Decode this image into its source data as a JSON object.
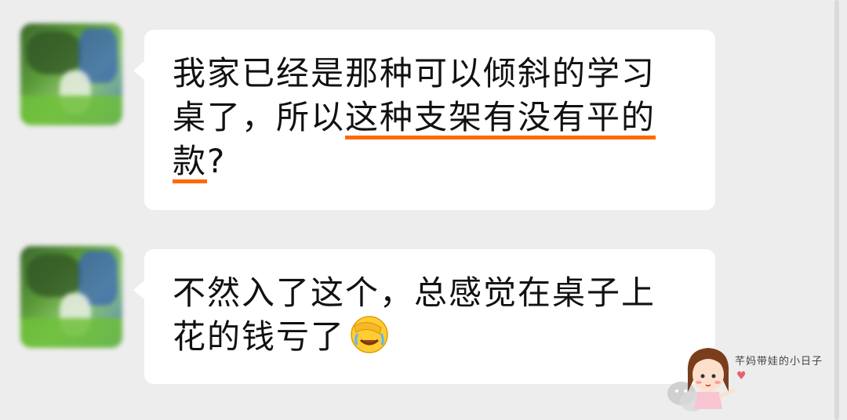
{
  "chat": {
    "messages": [
      {
        "sender": "other",
        "avatar_icon": "blurred-avatar-icon",
        "text_before": "我家已经是那种可以倾斜的学习桌了，所以",
        "text_highlight": "这种支架有没有平的款",
        "text_after": "?"
      },
      {
        "sender": "other",
        "avatar_icon": "blurred-avatar-icon",
        "text": "不然入了这个，总感觉在桌子上花的钱亏了",
        "emoji_icon": "face-palm-tears-emoji-icon"
      }
    ]
  },
  "watermark": {
    "label": "芊妈带娃的小日子",
    "heart_glyph": "♥",
    "chat_icon": "wechat-icon",
    "character_icon": "cartoon-girl-icon"
  },
  "colors": {
    "background": "#ededed",
    "bubble": "#ffffff",
    "highlight_underline": "#ff6a00",
    "text": "#111111"
  }
}
